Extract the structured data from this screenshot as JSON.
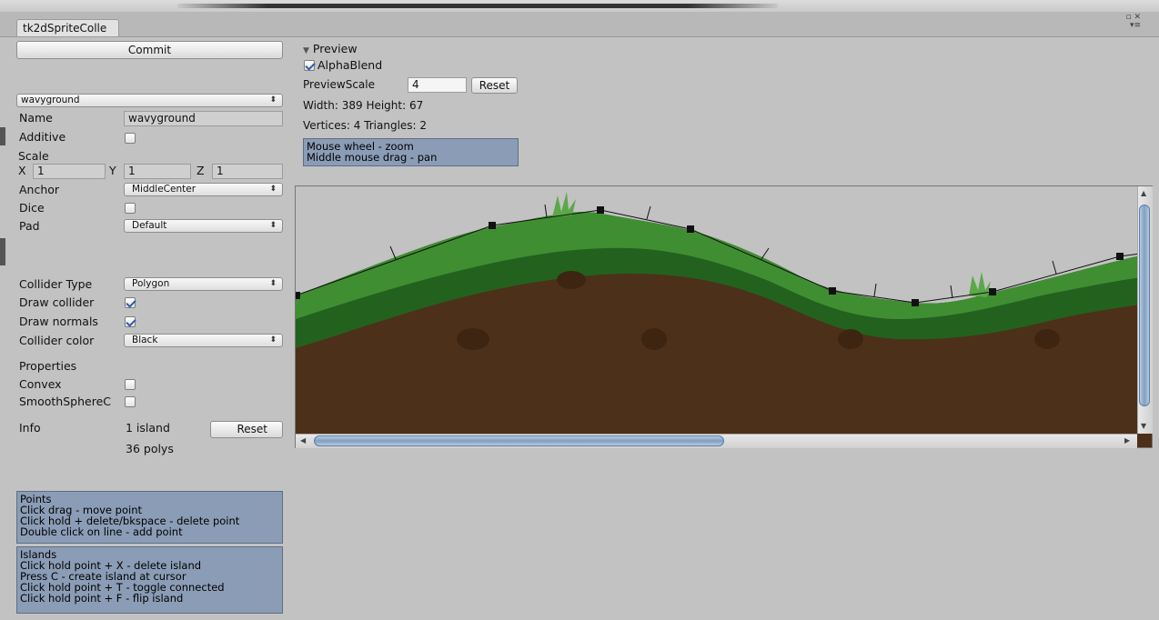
{
  "window": {
    "tab_title": "tk2dSpriteColle",
    "icons": [
      "▫ ✕",
      "▾≡"
    ]
  },
  "left": {
    "commit_label": "Commit",
    "sprite_select": "wavyground",
    "name_label": "Name",
    "name_value": "wavyground",
    "additive_label": "Additive",
    "additive_checked": false,
    "scale_label": "Scale",
    "scale": {
      "x_label": "X",
      "x": "1",
      "y_label": "Y",
      "y": "1",
      "z_label": "Z",
      "z": "1"
    },
    "anchor_label": "Anchor",
    "anchor_value": "MiddleCenter",
    "dice_label": "Dice",
    "dice_checked": false,
    "pad_label": "Pad",
    "pad_value": "Default",
    "collider_type_label": "Collider Type",
    "collider_type_value": "Polygon",
    "draw_collider_label": "Draw collider",
    "draw_collider_checked": true,
    "draw_normals_label": "Draw normals",
    "draw_normals_checked": true,
    "collider_color_label": "Collider color",
    "collider_color_value": "Black",
    "properties_label": "Properties",
    "convex_label": "Convex",
    "convex_checked": false,
    "smooth_label": "SmoothSphereC",
    "smooth_checked": false,
    "info_label": "Info",
    "info_islands": "1 island",
    "info_polys": "36 polys",
    "info_reset_label": "Reset",
    "help_points": [
      "Points",
      "Click drag - move point",
      "Click hold + delete/bkspace - delete point",
      "Double click on line - add point"
    ],
    "help_islands": [
      "Islands",
      "Click hold point + X - delete island",
      "Press C - create island at cursor",
      "Click hold point + T - toggle connected",
      "Click hold point + F - flip island"
    ]
  },
  "preview": {
    "header": "Preview",
    "alphablend_label": "AlphaBlend",
    "alphablend_checked": true,
    "scale_label": "PreviewScale",
    "scale_value": "4",
    "reset_label": "Reset",
    "size_text": "Width: 389 Height: 67",
    "verts_text": "Vertices: 4 Triangles: 2",
    "help": [
      "Mouse wheel - zoom",
      "Middle mouse drag - pan"
    ]
  },
  "colors": {
    "grass_light": "#3f8f32",
    "grass_dark": "#23611f",
    "dirt": "#4d3019",
    "help_bg": "#8b9cb6",
    "collider": "#111111"
  }
}
